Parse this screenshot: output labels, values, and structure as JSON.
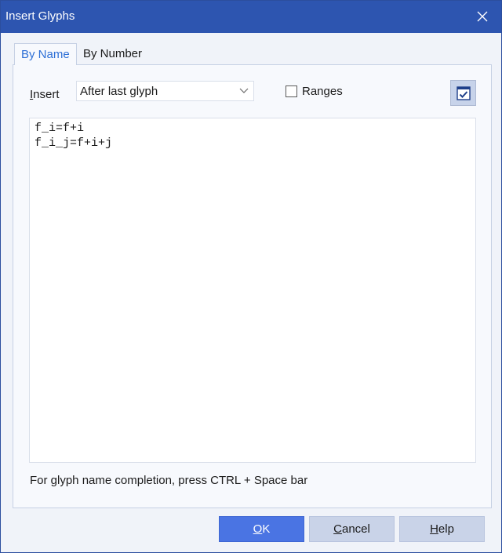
{
  "window": {
    "title": "Insert Glyphs"
  },
  "tabs": [
    {
      "label": "By Name",
      "active": true
    },
    {
      "label": "By Number",
      "active": false
    }
  ],
  "insert": {
    "label_mnemonic": "I",
    "label_rest": "nsert",
    "selected": "After last glyph"
  },
  "ranges": {
    "label": "Ranges",
    "checked": false
  },
  "editor": {
    "lines": [
      "f_i=f+i",
      "f_i_j=f+i+j"
    ]
  },
  "hint": "For glyph name completion, press CTRL + Space bar",
  "buttons": {
    "ok": {
      "mnemonic": "O",
      "rest": "K"
    },
    "cancel": {
      "mnemonic": "C",
      "rest": "ancel"
    },
    "help": {
      "mnemonic": "H",
      "rest": "elp"
    }
  },
  "colors": {
    "titlebar": "#2d55b0",
    "dialog_bg": "#f0f3f9",
    "accent": "#4a74e3",
    "tab_active_text": "#2d6fd6"
  },
  "icons": {
    "close": "close-icon",
    "dropdown": "chevron-down-icon",
    "toggle": "checkbox-window-icon"
  }
}
